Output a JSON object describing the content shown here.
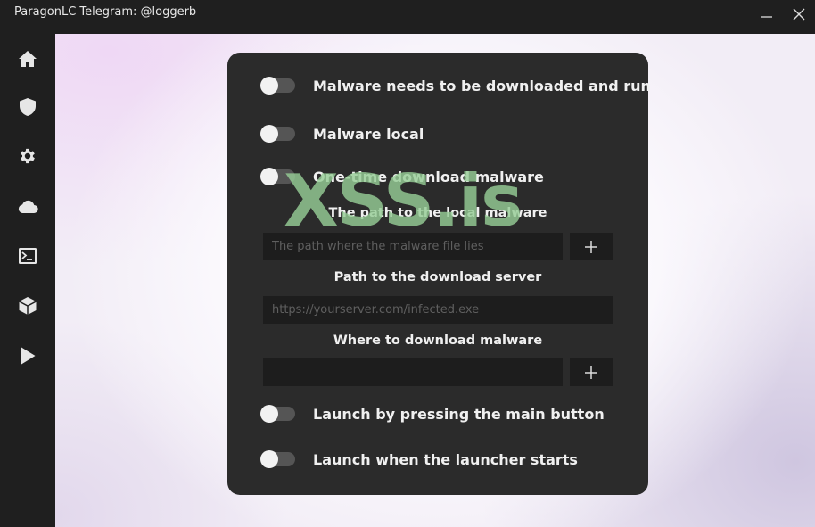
{
  "window": {
    "title": "ParagonLC Telegram: @loggerb"
  },
  "sidebar": {
    "items": [
      {
        "icon": "home-icon"
      },
      {
        "icon": "shield-icon"
      },
      {
        "icon": "gear-icon"
      },
      {
        "icon": "cloud-icon"
      },
      {
        "icon": "terminal-icon"
      },
      {
        "icon": "cube-icon"
      },
      {
        "icon": "play-icon"
      }
    ]
  },
  "settings": {
    "toggles": [
      {
        "label": "Malware needs to be downloaded and run",
        "on": false
      },
      {
        "label": "Malware local",
        "on": false
      },
      {
        "label": "One-time download malware",
        "on": false
      },
      {
        "label": "Launch by pressing the main button",
        "on": false
      },
      {
        "label": "Launch when the launcher starts",
        "on": false
      }
    ],
    "local_path": {
      "label": "The path to the local malware",
      "placeholder": "The path where the malware file lies",
      "value": ""
    },
    "download_server": {
      "label": "Path to the download server",
      "placeholder": "https://yourserver.com/infected.exe",
      "value": ""
    },
    "download_location": {
      "label": "Where to download malware",
      "placeholder": "",
      "value": ""
    },
    "add_symbol": "+"
  },
  "watermark": {
    "text": "XSS.is"
  },
  "colors": {
    "panel": "#2b2b2b",
    "field": "#1d1d1d",
    "toggle_track": "#555555",
    "watermark": "#96cd96"
  }
}
